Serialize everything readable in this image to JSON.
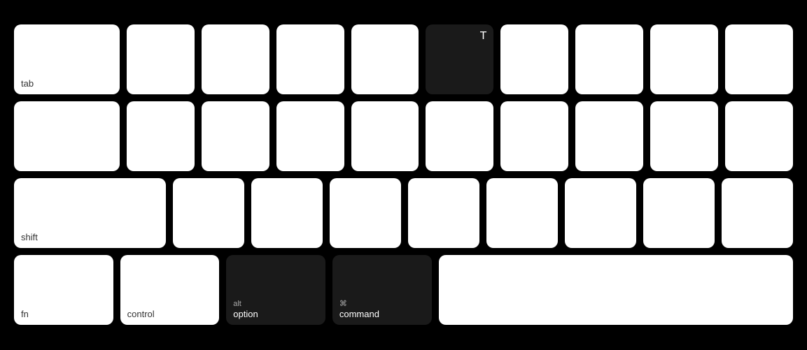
{
  "keyboard": {
    "rows": [
      {
        "id": "row1",
        "keys": [
          {
            "id": "tab",
            "label": "tab",
            "sublabel": "",
            "top": "",
            "dark": false,
            "wide": true
          },
          {
            "id": "q",
            "label": "",
            "sublabel": "",
            "top": "",
            "dark": false,
            "wide": false
          },
          {
            "id": "w",
            "label": "",
            "sublabel": "",
            "top": "",
            "dark": false,
            "wide": false
          },
          {
            "id": "e",
            "label": "",
            "sublabel": "",
            "top": "",
            "dark": false,
            "wide": false
          },
          {
            "id": "r",
            "label": "",
            "sublabel": "",
            "top": "",
            "dark": false,
            "wide": false
          },
          {
            "id": "t",
            "label": "T",
            "sublabel": "",
            "top": "",
            "dark": true,
            "wide": false
          },
          {
            "id": "y",
            "label": "",
            "sublabel": "",
            "top": "",
            "dark": false,
            "wide": false
          },
          {
            "id": "u",
            "label": "",
            "sublabel": "",
            "top": "",
            "dark": false,
            "wide": false
          },
          {
            "id": "i",
            "label": "",
            "sublabel": "",
            "top": "",
            "dark": false,
            "wide": false
          },
          {
            "id": "o",
            "label": "",
            "sublabel": "",
            "top": "",
            "dark": false,
            "wide": false
          }
        ]
      },
      {
        "id": "row2",
        "keys": [
          {
            "id": "caps",
            "label": "",
            "sublabel": "",
            "top": "",
            "dark": false,
            "wide": true
          },
          {
            "id": "a",
            "label": "",
            "sublabel": "",
            "top": "",
            "dark": false,
            "wide": false
          },
          {
            "id": "s",
            "label": "",
            "sublabel": "",
            "top": "",
            "dark": false,
            "wide": false
          },
          {
            "id": "d",
            "label": "",
            "sublabel": "",
            "top": "",
            "dark": false,
            "wide": false
          },
          {
            "id": "f",
            "label": "",
            "sublabel": "",
            "top": "",
            "dark": false,
            "wide": false
          },
          {
            "id": "g",
            "label": "",
            "sublabel": "",
            "top": "",
            "dark": false,
            "wide": false
          },
          {
            "id": "h",
            "label": "",
            "sublabel": "",
            "top": "",
            "dark": false,
            "wide": false
          },
          {
            "id": "j",
            "label": "",
            "sublabel": "",
            "top": "",
            "dark": false,
            "wide": false
          },
          {
            "id": "k",
            "label": "",
            "sublabel": "",
            "top": "",
            "dark": false,
            "wide": false
          },
          {
            "id": "l",
            "label": "",
            "sublabel": "",
            "top": "",
            "dark": false,
            "wide": false
          }
        ]
      },
      {
        "id": "row3",
        "keys": [
          {
            "id": "shift",
            "label": "shift",
            "sublabel": "",
            "top": "",
            "dark": false,
            "wide": "wider"
          },
          {
            "id": "z",
            "label": "",
            "sublabel": "",
            "top": "",
            "dark": false,
            "wide": false
          },
          {
            "id": "x",
            "label": "",
            "sublabel": "",
            "top": "",
            "dark": false,
            "wide": false
          },
          {
            "id": "c",
            "label": "",
            "sublabel": "",
            "top": "",
            "dark": false,
            "wide": false
          },
          {
            "id": "v",
            "label": "",
            "sublabel": "",
            "top": "",
            "dark": false,
            "wide": false
          },
          {
            "id": "b",
            "label": "",
            "sublabel": "",
            "top": "",
            "dark": false,
            "wide": false
          },
          {
            "id": "n",
            "label": "",
            "sublabel": "",
            "top": "",
            "dark": false,
            "wide": false
          },
          {
            "id": "m",
            "label": "",
            "sublabel": "",
            "top": "",
            "dark": false,
            "wide": false
          },
          {
            "id": "comma",
            "label": "",
            "sublabel": "",
            "top": "",
            "dark": false,
            "wide": false
          }
        ]
      },
      {
        "id": "row4",
        "keys": [
          {
            "id": "fn",
            "label": "fn",
            "sublabel": "",
            "top": "",
            "dark": false,
            "wide": false
          },
          {
            "id": "control",
            "label": "control",
            "sublabel": "",
            "top": "",
            "dark": false,
            "wide": false
          },
          {
            "id": "alt-option",
            "label": "option",
            "sublabel": "alt",
            "top": "",
            "dark": true,
            "wide": false
          },
          {
            "id": "command",
            "label": "command",
            "sublabel": "⌘",
            "top": "",
            "dark": true,
            "wide": false
          },
          {
            "id": "spacebar",
            "label": "",
            "sublabel": "",
            "top": "",
            "dark": false,
            "wide": "space"
          }
        ]
      }
    ]
  }
}
